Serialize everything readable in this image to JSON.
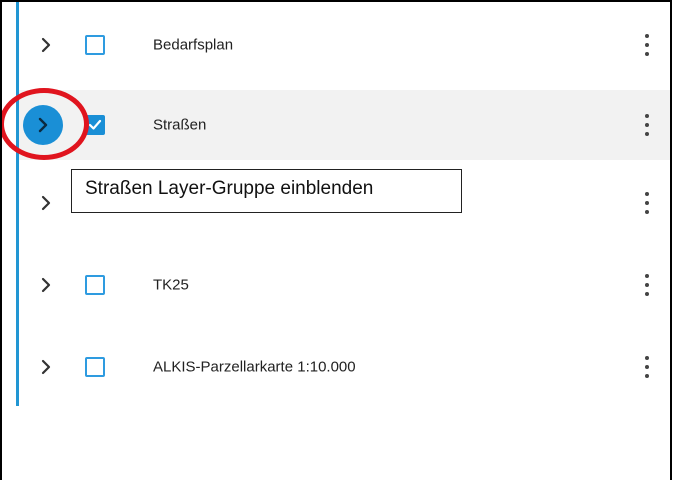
{
  "layers": [
    {
      "label": "Bedarfsplan",
      "checked": false,
      "active": false
    },
    {
      "label": "Straßen",
      "checked": true,
      "active": true
    },
    {
      "label": "",
      "checked": false,
      "active": false
    },
    {
      "label": "TK25",
      "checked": false,
      "active": false
    },
    {
      "label": "ALKIS-Parzellarkarte 1:10.000",
      "checked": false,
      "active": false
    }
  ],
  "tooltip": {
    "text": "Straßen Layer-Gruppe einblenden"
  },
  "colors": {
    "accent": "#1a8fd6",
    "highlight_circle": "#e0141e",
    "active_row_bg": "#f2f2f2"
  },
  "icons": {
    "expand": "chevron-right-icon",
    "menu": "more-vertical-icon",
    "checkbox": "checkbox-icon"
  }
}
